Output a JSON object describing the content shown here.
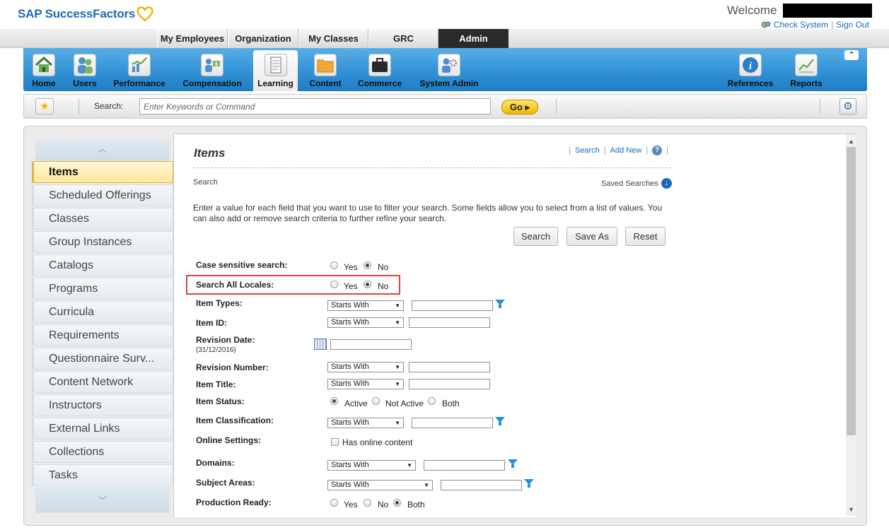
{
  "header": {
    "logo_text": "SAP SuccessFactors",
    "welcome_text": "Welcome",
    "check_system": "Check System",
    "sign_out": "Sign Out",
    "separator": "|"
  },
  "top_tabs": [
    "My Employees",
    "Organization",
    "My Classes",
    "GRC",
    "Admin"
  ],
  "nav": {
    "items": [
      {
        "label": "Home",
        "icon": "home-icon"
      },
      {
        "label": "Users",
        "icon": "users-icon"
      },
      {
        "label": "Performance",
        "icon": "performance-chart-icon"
      },
      {
        "label": "Compensation",
        "icon": "compensation-icon"
      },
      {
        "label": "Learning",
        "icon": "document-icon",
        "active": true
      },
      {
        "label": "Content",
        "icon": "folder-icon"
      },
      {
        "label": "Commerce",
        "icon": "briefcase-icon"
      },
      {
        "label": "System Admin",
        "icon": "gear-user-icon"
      },
      {
        "label": "References",
        "icon": "info-icon"
      },
      {
        "label": "Reports",
        "icon": "report-chart-icon"
      }
    ],
    "collapse_symbol": "⌃"
  },
  "search_bar": {
    "label": "Search:",
    "placeholder": "Enter Keywords or Command",
    "go_label": "Go",
    "go_arrow": "▸"
  },
  "left_nav": {
    "items": [
      "Items",
      "Scheduled Offerings",
      "Classes",
      "Group Instances",
      "Catalogs",
      "Programs",
      "Curricula",
      "Requirements",
      "Questionnaire Surv...",
      "Content Network",
      "Instructors",
      "External Links",
      "Collections",
      "Tasks"
    ],
    "active_index": 0,
    "scroll_up": "︿",
    "scroll_down": "﹀"
  },
  "main": {
    "title": "Items",
    "links": {
      "search": "Search",
      "add_new": "Add New",
      "sep": "|",
      "help": "?"
    },
    "sub_label": "Search",
    "saved_searches": "Saved Searches",
    "instructions": "Enter a value for each field that you want to use to filter your search. Some fields allow you to select from a list of values. You can also add or remove search criteria to further refine your search.",
    "buttons": {
      "search": "Search",
      "save_as": "Save As",
      "reset": "Reset"
    }
  },
  "form": {
    "case_sensitive": {
      "label": "Case sensitive search:",
      "yes": "Yes",
      "no": "No",
      "selected": "No"
    },
    "all_locales": {
      "label": "Search All Locales:",
      "yes": "Yes",
      "no": "No",
      "selected": "No"
    },
    "item_types": {
      "label": "Item Types:",
      "operator": "Starts With",
      "value": ""
    },
    "item_id": {
      "label": "Item ID:",
      "operator": "Starts With",
      "value": ""
    },
    "revision_date": {
      "label": "Revision Date:",
      "format_hint": "(31/12/2016)",
      "value": ""
    },
    "revision_number": {
      "label": "Revision Number:",
      "operator": "Starts With",
      "value": ""
    },
    "item_title": {
      "label": "Item Title:",
      "operator": "Starts With",
      "value": ""
    },
    "item_status": {
      "label": "Item Status:",
      "options": [
        "Active",
        "Not Active",
        "Both"
      ],
      "selected": "Active"
    },
    "item_classification": {
      "label": "Item Classification:",
      "operator": "Starts With",
      "value": ""
    },
    "online_settings": {
      "label": "Online Settings:",
      "checkbox_label": "Has online content",
      "checked": false
    },
    "domains": {
      "label": "Domains:",
      "operator": "Starts With",
      "value": ""
    },
    "subject_areas": {
      "label": "Subject Areas:",
      "operator": "Starts With",
      "value": ""
    },
    "production_ready": {
      "label": "Production Ready:",
      "options": [
        "Yes",
        "No",
        "Both"
      ],
      "selected": "Both"
    }
  }
}
